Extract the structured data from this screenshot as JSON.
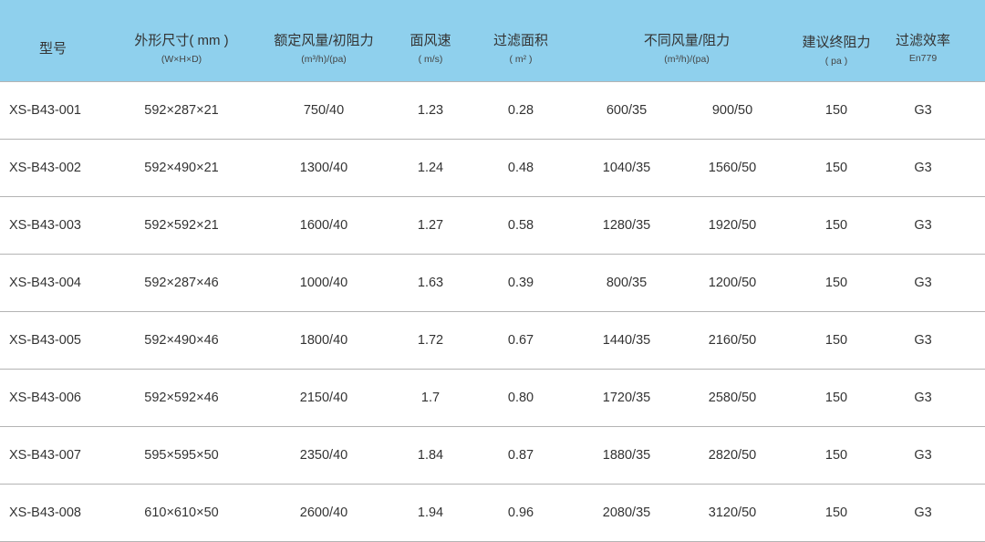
{
  "headers": {
    "model": "型号",
    "size": "外形尺寸( mm )",
    "size_sub": "(W×H×D)",
    "rated": "额定风量/初阻力",
    "rated_sub": "(m³/h)/(pa)",
    "velocity": "面风速",
    "velocity_sub": "( m/s)",
    "area": "过滤面积",
    "area_sub": "( m² )",
    "diff": "不同风量/阻力",
    "diff_sub": "(m³/h)/(pa)",
    "final": "建议终阻力",
    "final_sub": "( pa )",
    "eff": "过滤效率",
    "eff_sub": "En779"
  },
  "rows": [
    {
      "model": "XS-B43-001",
      "size": "592×287×21",
      "rated": "750/40",
      "velocity": "1.23",
      "area": "0.28",
      "d1": "600/35",
      "d2": "900/50",
      "final": "150",
      "eff": "G3"
    },
    {
      "model": "XS-B43-002",
      "size": "592×490×21",
      "rated": "1300/40",
      "velocity": "1.24",
      "area": "0.48",
      "d1": "1040/35",
      "d2": "1560/50",
      "final": "150",
      "eff": "G3"
    },
    {
      "model": "XS-B43-003",
      "size": "592×592×21",
      "rated": "1600/40",
      "velocity": "1.27",
      "area": "0.58",
      "d1": "1280/35",
      "d2": "1920/50",
      "final": "150",
      "eff": "G3"
    },
    {
      "model": "XS-B43-004",
      "size": "592×287×46",
      "rated": "1000/40",
      "velocity": "1.63",
      "area": "0.39",
      "d1": "800/35",
      "d2": "1200/50",
      "final": "150",
      "eff": "G3"
    },
    {
      "model": "XS-B43-005",
      "size": "592×490×46",
      "rated": "1800/40",
      "velocity": "1.72",
      "area": "0.67",
      "d1": "1440/35",
      "d2": "2160/50",
      "final": "150",
      "eff": "G3"
    },
    {
      "model": "XS-B43-006",
      "size": "592×592×46",
      "rated": "2150/40",
      "velocity": "1.7",
      "area": "0.80",
      "d1": "1720/35",
      "d2": "2580/50",
      "final": "150",
      "eff": "G3"
    },
    {
      "model": "XS-B43-007",
      "size": "595×595×50",
      "rated": "2350/40",
      "velocity": "1.84",
      "area": "0.87",
      "d1": "1880/35",
      "d2": "2820/50",
      "final": "150",
      "eff": "G3"
    },
    {
      "model": "XS-B43-008",
      "size": "610×610×50",
      "rated": "2600/40",
      "velocity": "1.94",
      "area": "0.96",
      "d1": "2080/35",
      "d2": "3120/50",
      "final": "150",
      "eff": "G3"
    }
  ],
  "colors": {
    "header_bg": "#8fd0ed",
    "divider": "#b4b4b4",
    "text": "#333333"
  }
}
